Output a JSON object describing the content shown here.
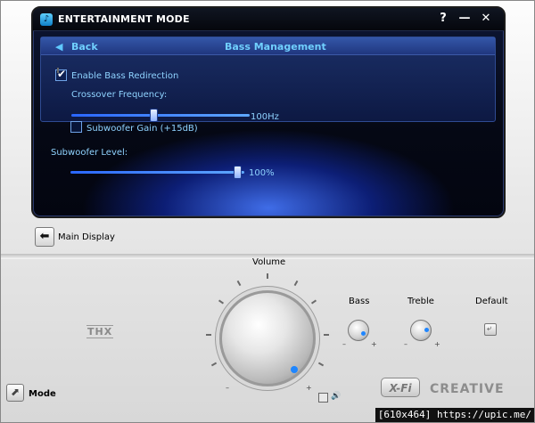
{
  "window": {
    "title": "ENTERTAINMENT MODE",
    "help_symbol": "?",
    "minimize_symbol": "—",
    "close_symbol": "✕",
    "icon": "app-note-icon"
  },
  "bass_management": {
    "back_label": "Back",
    "title": "Bass Management",
    "enable_bass_redirection": {
      "label": "Enable Bass Redirection",
      "checked": true
    },
    "crossover_frequency": {
      "label": "Crossover Frequency:",
      "value": "100Hz"
    },
    "subwoofer_gain": {
      "label": "Subwoofer Gain (+15dB)",
      "checked": false
    },
    "subwoofer_level": {
      "label": "Subwoofer Level:",
      "value": "100%"
    }
  },
  "main_display": {
    "label": "Main Display"
  },
  "controls": {
    "volume_label": "Volume",
    "bass_label": "Bass",
    "treble_label": "Treble",
    "default_label": "Default",
    "minus": "–",
    "plus": "+"
  },
  "bottom": {
    "mode_label": "Mode",
    "brand_thx": "THX",
    "brand_xfi": "X-Fi",
    "brand_creative": "CREATIVE"
  },
  "watermark": "[610x464] https://upic.me/",
  "colors": {
    "accent_blue": "#1f86ff",
    "panel_text": "#8fd3ff",
    "title_text": "#ffffff"
  }
}
